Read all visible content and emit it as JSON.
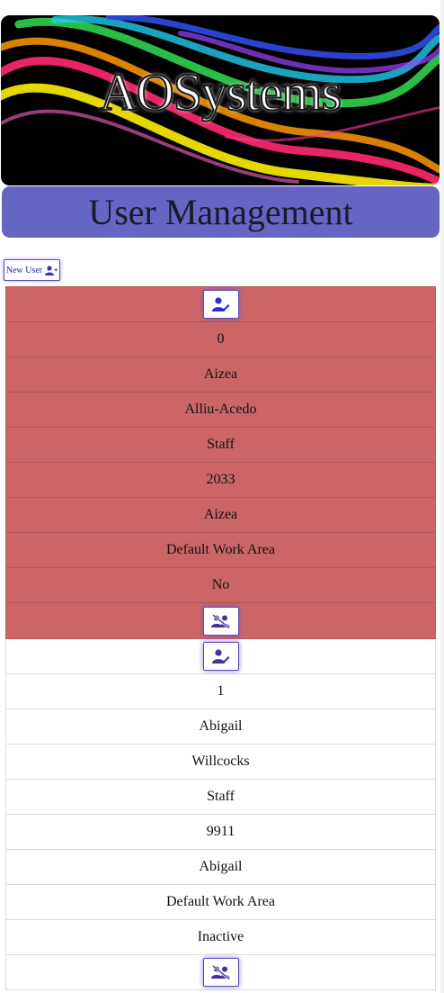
{
  "banner": {
    "logo_text": "AOSystems"
  },
  "page": {
    "title": "User Management"
  },
  "toolbar": {
    "new_user_label": "New User",
    "new_user_icon": "user-plus-icon"
  },
  "colors": {
    "title_bar": "#6765c4",
    "deleted_row": "#cc6666",
    "accent": "#3d2fb0"
  },
  "users": [
    {
      "edit_icon": "user-edit-icon",
      "id": "0",
      "first_name": "Aizea",
      "last_name": "Alliu-Acedo",
      "role": "Staff",
      "pin": "2033",
      "display_name": "Aizea",
      "work_area": "Default Work Area",
      "status": "No",
      "delete_icon": "user-delete-icon",
      "highlight": "deleted"
    },
    {
      "edit_icon": "user-edit-icon",
      "id": "1",
      "first_name": "Abigail",
      "last_name": "Willcocks",
      "role": "Staff",
      "pin": "9911",
      "display_name": "Abigail",
      "work_area": "Default Work Area",
      "status": "Inactive",
      "delete_icon": "user-delete-icon",
      "highlight": "normal"
    }
  ]
}
